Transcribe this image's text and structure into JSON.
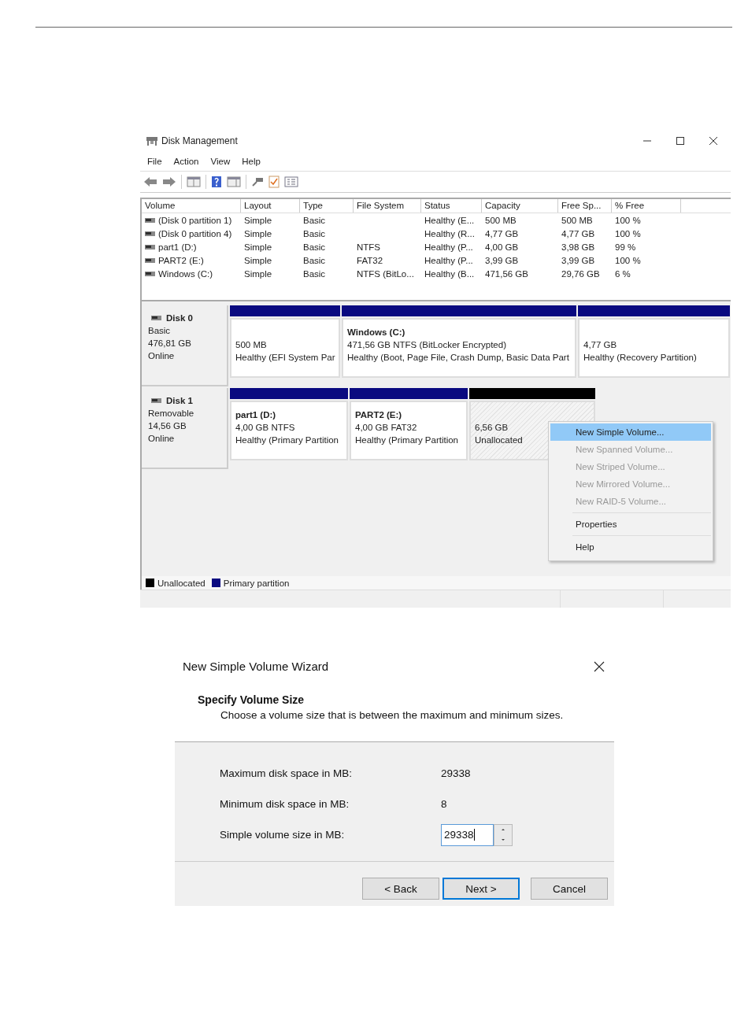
{
  "disk_management": {
    "title": "Disk Management",
    "menu": [
      "File",
      "Action",
      "View",
      "Help"
    ],
    "columns": [
      "Volume",
      "Layout",
      "Type",
      "File System",
      "Status",
      "Capacity",
      "Free Sp...",
      "% Free"
    ],
    "rows": [
      [
        "(Disk 0 partition 1)",
        "Simple",
        "Basic",
        "",
        "Healthy (E...",
        "500 MB",
        "500 MB",
        "100 %"
      ],
      [
        "(Disk 0 partition 4)",
        "Simple",
        "Basic",
        "",
        "Healthy (R...",
        "4,77 GB",
        "4,77 GB",
        "100 %"
      ],
      [
        "part1 (D:)",
        "Simple",
        "Basic",
        "NTFS",
        "Healthy (P...",
        "4,00 GB",
        "3,98 GB",
        "99 %"
      ],
      [
        "PART2 (E:)",
        "Simple",
        "Basic",
        "FAT32",
        "Healthy (P...",
        "3,99 GB",
        "3,99 GB",
        "100 %"
      ],
      [
        "Windows (C:)",
        "Simple",
        "Basic",
        "NTFS (BitLo...",
        "Healthy (B...",
        "471,56 GB",
        "29,76 GB",
        "6 %"
      ]
    ],
    "disks": [
      {
        "name": "Disk 0",
        "type": "Basic",
        "size": "476,81 GB",
        "status": "Online",
        "partitions": [
          {
            "kind": "primary",
            "lines": [
              "500 MB",
              "Healthy (EFI System Par"
            ]
          },
          {
            "kind": "primary",
            "name": "Windows  (C:)",
            "lines": [
              "471,56 GB NTFS (BitLocker Encrypted)",
              "Healthy (Boot, Page File, Crash Dump, Basic Data Part"
            ]
          },
          {
            "kind": "primary",
            "lines": [
              "4,77 GB",
              "Healthy (Recovery Partition)"
            ]
          }
        ]
      },
      {
        "name": "Disk 1",
        "type": "Removable",
        "size": "14,56 GB",
        "status": "Online",
        "partitions": [
          {
            "kind": "primary",
            "name": "part1  (D:)",
            "lines": [
              "4,00 GB NTFS",
              "Healthy (Primary Partition"
            ]
          },
          {
            "kind": "primary",
            "name": "PART2  (E:)",
            "lines": [
              "4,00 GB FAT32",
              "Healthy (Primary Partition"
            ]
          },
          {
            "kind": "unallocated",
            "lines": [
              "6,56 GB",
              "Unallocated"
            ]
          }
        ]
      }
    ],
    "context_menu": [
      [
        {
          "label": "New Simple Volume...",
          "disabled": false,
          "selected": true
        },
        {
          "label": "New Spanned Volume...",
          "disabled": true,
          "selected": false
        },
        {
          "label": "New Striped Volume...",
          "disabled": true,
          "selected": false
        },
        {
          "label": "New Mirrored Volume...",
          "disabled": true,
          "selected": false
        },
        {
          "label": "New RAID-5 Volume...",
          "disabled": true,
          "selected": false
        }
      ],
      [
        {
          "label": "Properties",
          "disabled": false,
          "selected": false
        }
      ],
      [
        {
          "label": "Help",
          "disabled": false,
          "selected": false
        }
      ]
    ],
    "legend": [
      {
        "label": "Unallocated",
        "color": "#000000"
      },
      {
        "label": "Primary partition",
        "color": "#0a0a80"
      }
    ]
  },
  "wizard": {
    "title": "New Simple Volume Wizard",
    "heading": "Specify Volume Size",
    "subheading": "Choose a volume size that is between the maximum and minimum sizes.",
    "fields": [
      {
        "kind": "text",
        "label": "Maximum disk space in MB:",
        "value": "29338"
      },
      {
        "kind": "text",
        "label": "Minimum disk space in MB:",
        "value": "8"
      },
      {
        "kind": "spin",
        "label": "Simple volume size in MB:",
        "value": "29338"
      }
    ],
    "buttons": [
      {
        "label": "< Back",
        "default": false
      },
      {
        "label": "Next >",
        "default": true
      },
      {
        "label": "Cancel",
        "default": false
      }
    ]
  }
}
